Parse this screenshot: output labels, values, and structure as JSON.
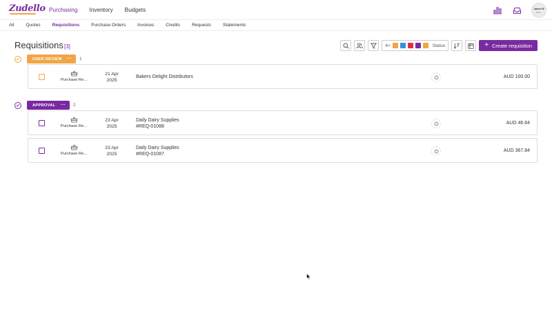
{
  "app": {
    "logo": "Zudello"
  },
  "main_nav": [
    {
      "label": "Purchasing",
      "active": true
    },
    {
      "label": "Inventory",
      "active": false
    },
    {
      "label": "Budgets",
      "active": false
    }
  ],
  "user": {
    "initials": "James W",
    "subtitle": "Zud..."
  },
  "sub_nav": [
    {
      "label": "All",
      "active": false
    },
    {
      "label": "Quotes",
      "active": false
    },
    {
      "label": "Requisitions",
      "active": true
    },
    {
      "label": "Purchase Orders",
      "active": false
    },
    {
      "label": "Invoices",
      "active": false
    },
    {
      "label": "Credits",
      "active": false
    },
    {
      "label": "Requests",
      "active": false
    },
    {
      "label": "Statements",
      "active": false
    }
  ],
  "page": {
    "title": "Requisitions",
    "count": "[3]"
  },
  "toolbar": {
    "legend_prefix": "4+",
    "legend_colors": [
      "#f2a546",
      "#3a8fd8",
      "#d9304a",
      "#7a2aa0",
      "#f2a546"
    ],
    "status_label": "Status",
    "create_label": "Create requisition",
    "icons": [
      "search-icon",
      "users-icon",
      "filter-icon",
      "sort-icon",
      "calendar-icon"
    ]
  },
  "colors": {
    "accent": "#7a2aa0",
    "user_review": "#f2a546",
    "approval": "#7a2aa0"
  },
  "groups": [
    {
      "tag": "USER REVIEW",
      "dots": "···",
      "count": "1",
      "color": "#f2a546",
      "rows": [
        {
          "type": "Purchase Re...",
          "date_line1": "21 Apr",
          "date_line2": "2025",
          "vendor": "Bakers Delight Distributors",
          "reference": "",
          "amount": "AUD 100.00"
        }
      ]
    },
    {
      "tag": "APPROVAL",
      "dots": "···",
      "count": "2",
      "color": "#7a2aa0",
      "rows": [
        {
          "type": "Purchase Re...",
          "date_line1": "23 Apr",
          "date_line2": "2025",
          "vendor": "Daily Dairy Supplies",
          "reference": "#REQ-01088",
          "amount": "AUD 46.64"
        },
        {
          "type": "Purchase Re...",
          "date_line1": "23 Apr",
          "date_line2": "2025",
          "vendor": "Daily Dairy Supplies",
          "reference": "#REQ-01087",
          "amount": "AUD 367.84"
        }
      ]
    }
  ]
}
